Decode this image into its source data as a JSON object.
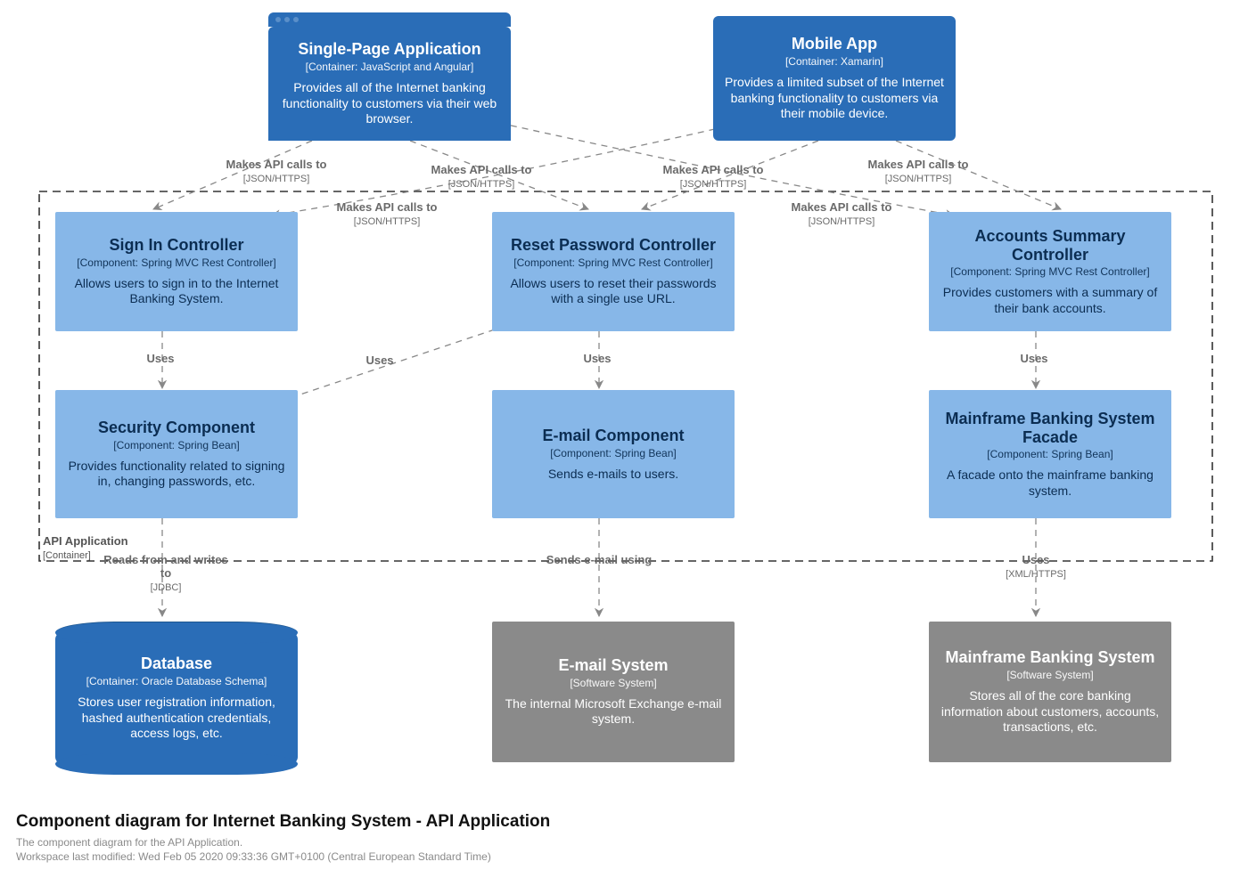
{
  "boundary": {
    "name": "API Application",
    "meta": "[Container]"
  },
  "nodes": {
    "spa": {
      "title": "Single-Page Application",
      "meta": "[Container: JavaScript and Angular]",
      "desc": "Provides all of the Internet banking functionality to customers via their web browser."
    },
    "mobile": {
      "title": "Mobile App",
      "meta": "[Container: Xamarin]",
      "desc": "Provides a limited subset of the Internet banking functionality to customers via their mobile device."
    },
    "signin": {
      "title": "Sign In Controller",
      "meta": "[Component: Spring MVC Rest Controller]",
      "desc": "Allows users to sign in to the Internet Banking System."
    },
    "reset": {
      "title": "Reset Password Controller",
      "meta": "[Component: Spring MVC Rest Controller]",
      "desc": "Allows users to reset their passwords with a single use URL."
    },
    "accounts": {
      "title": "Accounts Summary Controller",
      "meta": "[Component: Spring MVC Rest Controller]",
      "desc": "Provides customers with a summary of their bank accounts."
    },
    "security": {
      "title": "Security Component",
      "meta": "[Component: Spring Bean]",
      "desc": "Provides functionality related to signing in, changing passwords, etc."
    },
    "email": {
      "title": "E-mail Component",
      "meta": "[Component: Spring Bean]",
      "desc": "Sends e-mails to users."
    },
    "facade": {
      "title": "Mainframe Banking System Facade",
      "meta": "[Component: Spring Bean]",
      "desc": "A facade onto the mainframe banking system."
    },
    "db": {
      "title": "Database",
      "meta": "[Container: Oracle Database Schema]",
      "desc": "Stores user registration information, hashed authentication credentials, access logs, etc."
    },
    "emailsys": {
      "title": "E-mail System",
      "meta": "[Software System]",
      "desc": "The internal Microsoft Exchange e-mail system."
    },
    "mainframe": {
      "title": "Mainframe Banking System",
      "meta": "[Software System]",
      "desc": "Stores all of the core banking information about customers, accounts, transactions, etc."
    }
  },
  "rels": {
    "api_call": {
      "label": "Makes API calls to",
      "sub": "[JSON/HTTPS]"
    },
    "uses": {
      "label": "Uses",
      "sub": ""
    },
    "reads": {
      "label": "Reads from and writes to",
      "sub": "[JDBC]"
    },
    "sends": {
      "label": "Sends e-mail using",
      "sub": ""
    },
    "uses_xml": {
      "label": "Uses",
      "sub": "[XML/HTTPS]"
    }
  },
  "footer": {
    "title": "Component diagram for Internet Banking System - API Application",
    "sub1": "The component diagram for the API Application.",
    "sub2": "Workspace last modified: Wed Feb 05 2020 09:33:36 GMT+0100 (Central European Standard Time)"
  }
}
